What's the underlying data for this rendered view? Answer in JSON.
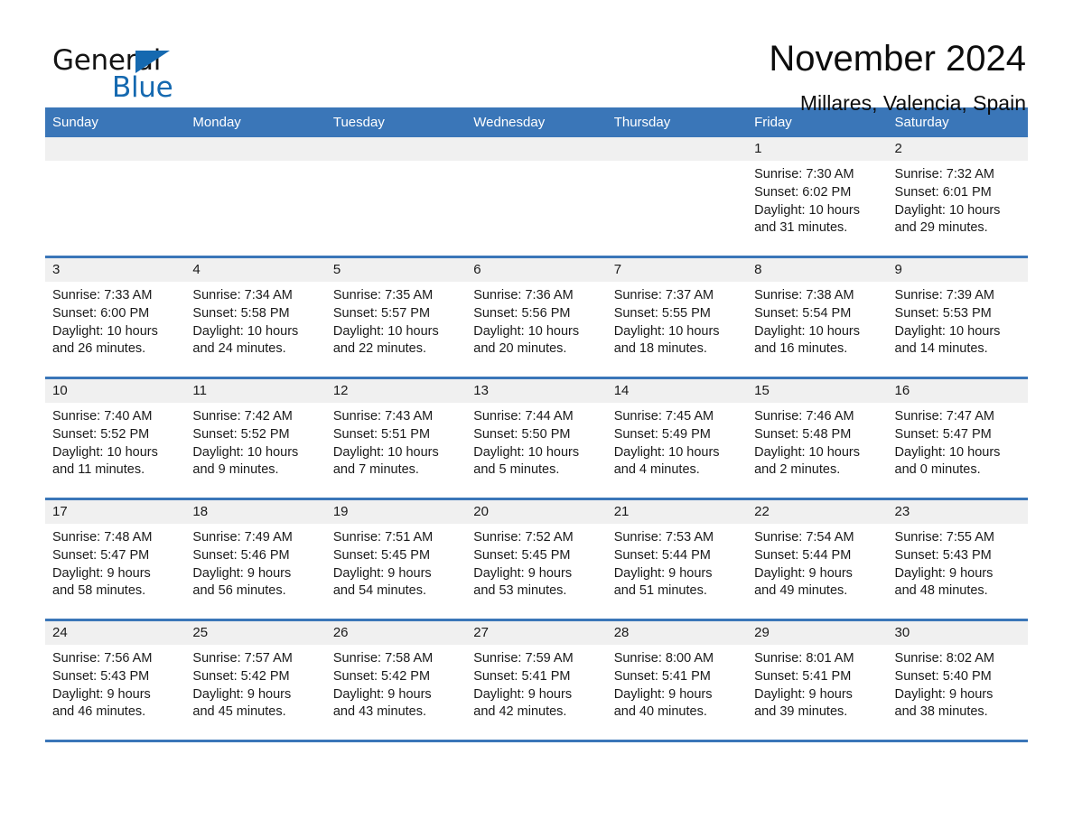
{
  "logo": {
    "word_one": "General",
    "word_two": "Blue",
    "triangle_icon": "triangle-icon",
    "brand_color": "#1569b0"
  },
  "header": {
    "title": "November 2024",
    "subtitle": "Millares, Valencia, Spain"
  },
  "theme": {
    "header_blue": "#3a76b8",
    "daynum_band": "#f0f0f0",
    "text": "#1a1a1a"
  },
  "calendar": {
    "weekday_headers": [
      "Sunday",
      "Monday",
      "Tuesday",
      "Wednesday",
      "Thursday",
      "Friday",
      "Saturday"
    ],
    "labels": {
      "sunrise_prefix": "Sunrise: ",
      "sunset_prefix": "Sunset: ",
      "daylight_prefix": "Daylight: "
    },
    "weeks": [
      [
        {
          "day": "",
          "empty": true
        },
        {
          "day": "",
          "empty": true
        },
        {
          "day": "",
          "empty": true
        },
        {
          "day": "",
          "empty": true
        },
        {
          "day": "",
          "empty": true
        },
        {
          "day": "1",
          "sunrise": "Sunrise: 7:30 AM",
          "sunset": "Sunset: 6:02 PM",
          "daylight_1": "Daylight: 10 hours",
          "daylight_2": "and 31 minutes."
        },
        {
          "day": "2",
          "sunrise": "Sunrise: 7:32 AM",
          "sunset": "Sunset: 6:01 PM",
          "daylight_1": "Daylight: 10 hours",
          "daylight_2": "and 29 minutes."
        }
      ],
      [
        {
          "day": "3",
          "sunrise": "Sunrise: 7:33 AM",
          "sunset": "Sunset: 6:00 PM",
          "daylight_1": "Daylight: 10 hours",
          "daylight_2": "and 26 minutes."
        },
        {
          "day": "4",
          "sunrise": "Sunrise: 7:34 AM",
          "sunset": "Sunset: 5:58 PM",
          "daylight_1": "Daylight: 10 hours",
          "daylight_2": "and 24 minutes."
        },
        {
          "day": "5",
          "sunrise": "Sunrise: 7:35 AM",
          "sunset": "Sunset: 5:57 PM",
          "daylight_1": "Daylight: 10 hours",
          "daylight_2": "and 22 minutes."
        },
        {
          "day": "6",
          "sunrise": "Sunrise: 7:36 AM",
          "sunset": "Sunset: 5:56 PM",
          "daylight_1": "Daylight: 10 hours",
          "daylight_2": "and 20 minutes."
        },
        {
          "day": "7",
          "sunrise": "Sunrise: 7:37 AM",
          "sunset": "Sunset: 5:55 PM",
          "daylight_1": "Daylight: 10 hours",
          "daylight_2": "and 18 minutes."
        },
        {
          "day": "8",
          "sunrise": "Sunrise: 7:38 AM",
          "sunset": "Sunset: 5:54 PM",
          "daylight_1": "Daylight: 10 hours",
          "daylight_2": "and 16 minutes."
        },
        {
          "day": "9",
          "sunrise": "Sunrise: 7:39 AM",
          "sunset": "Sunset: 5:53 PM",
          "daylight_1": "Daylight: 10 hours",
          "daylight_2": "and 14 minutes."
        }
      ],
      [
        {
          "day": "10",
          "sunrise": "Sunrise: 7:40 AM",
          "sunset": "Sunset: 5:52 PM",
          "daylight_1": "Daylight: 10 hours",
          "daylight_2": "and 11 minutes."
        },
        {
          "day": "11",
          "sunrise": "Sunrise: 7:42 AM",
          "sunset": "Sunset: 5:52 PM",
          "daylight_1": "Daylight: 10 hours",
          "daylight_2": "and 9 minutes."
        },
        {
          "day": "12",
          "sunrise": "Sunrise: 7:43 AM",
          "sunset": "Sunset: 5:51 PM",
          "daylight_1": "Daylight: 10 hours",
          "daylight_2": "and 7 minutes."
        },
        {
          "day": "13",
          "sunrise": "Sunrise: 7:44 AM",
          "sunset": "Sunset: 5:50 PM",
          "daylight_1": "Daylight: 10 hours",
          "daylight_2": "and 5 minutes."
        },
        {
          "day": "14",
          "sunrise": "Sunrise: 7:45 AM",
          "sunset": "Sunset: 5:49 PM",
          "daylight_1": "Daylight: 10 hours",
          "daylight_2": "and 4 minutes."
        },
        {
          "day": "15",
          "sunrise": "Sunrise: 7:46 AM",
          "sunset": "Sunset: 5:48 PM",
          "daylight_1": "Daylight: 10 hours",
          "daylight_2": "and 2 minutes."
        },
        {
          "day": "16",
          "sunrise": "Sunrise: 7:47 AM",
          "sunset": "Sunset: 5:47 PM",
          "daylight_1": "Daylight: 10 hours",
          "daylight_2": "and 0 minutes."
        }
      ],
      [
        {
          "day": "17",
          "sunrise": "Sunrise: 7:48 AM",
          "sunset": "Sunset: 5:47 PM",
          "daylight_1": "Daylight: 9 hours",
          "daylight_2": "and 58 minutes."
        },
        {
          "day": "18",
          "sunrise": "Sunrise: 7:49 AM",
          "sunset": "Sunset: 5:46 PM",
          "daylight_1": "Daylight: 9 hours",
          "daylight_2": "and 56 minutes."
        },
        {
          "day": "19",
          "sunrise": "Sunrise: 7:51 AM",
          "sunset": "Sunset: 5:45 PM",
          "daylight_1": "Daylight: 9 hours",
          "daylight_2": "and 54 minutes."
        },
        {
          "day": "20",
          "sunrise": "Sunrise: 7:52 AM",
          "sunset": "Sunset: 5:45 PM",
          "daylight_1": "Daylight: 9 hours",
          "daylight_2": "and 53 minutes."
        },
        {
          "day": "21",
          "sunrise": "Sunrise: 7:53 AM",
          "sunset": "Sunset: 5:44 PM",
          "daylight_1": "Daylight: 9 hours",
          "daylight_2": "and 51 minutes."
        },
        {
          "day": "22",
          "sunrise": "Sunrise: 7:54 AM",
          "sunset": "Sunset: 5:44 PM",
          "daylight_1": "Daylight: 9 hours",
          "daylight_2": "and 49 minutes."
        },
        {
          "day": "23",
          "sunrise": "Sunrise: 7:55 AM",
          "sunset": "Sunset: 5:43 PM",
          "daylight_1": "Daylight: 9 hours",
          "daylight_2": "and 48 minutes."
        }
      ],
      [
        {
          "day": "24",
          "sunrise": "Sunrise: 7:56 AM",
          "sunset": "Sunset: 5:43 PM",
          "daylight_1": "Daylight: 9 hours",
          "daylight_2": "and 46 minutes."
        },
        {
          "day": "25",
          "sunrise": "Sunrise: 7:57 AM",
          "sunset": "Sunset: 5:42 PM",
          "daylight_1": "Daylight: 9 hours",
          "daylight_2": "and 45 minutes."
        },
        {
          "day": "26",
          "sunrise": "Sunrise: 7:58 AM",
          "sunset": "Sunset: 5:42 PM",
          "daylight_1": "Daylight: 9 hours",
          "daylight_2": "and 43 minutes."
        },
        {
          "day": "27",
          "sunrise": "Sunrise: 7:59 AM",
          "sunset": "Sunset: 5:41 PM",
          "daylight_1": "Daylight: 9 hours",
          "daylight_2": "and 42 minutes."
        },
        {
          "day": "28",
          "sunrise": "Sunrise: 8:00 AM",
          "sunset": "Sunset: 5:41 PM",
          "daylight_1": "Daylight: 9 hours",
          "daylight_2": "and 40 minutes."
        },
        {
          "day": "29",
          "sunrise": "Sunrise: 8:01 AM",
          "sunset": "Sunset: 5:41 PM",
          "daylight_1": "Daylight: 9 hours",
          "daylight_2": "and 39 minutes."
        },
        {
          "day": "30",
          "sunrise": "Sunrise: 8:02 AM",
          "sunset": "Sunset: 5:40 PM",
          "daylight_1": "Daylight: 9 hours",
          "daylight_2": "and 38 minutes."
        }
      ]
    ]
  }
}
